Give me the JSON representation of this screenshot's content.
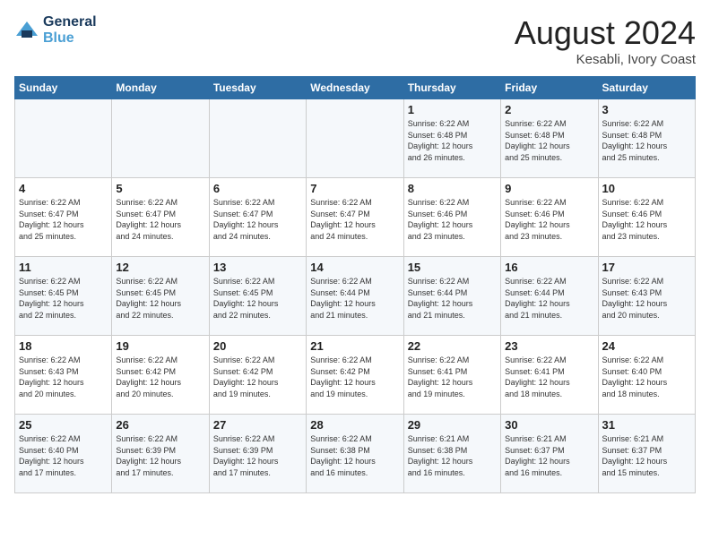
{
  "header": {
    "logo_line1": "General",
    "logo_line2": "Blue",
    "month_year": "August 2024",
    "location": "Kesabli, Ivory Coast"
  },
  "weekdays": [
    "Sunday",
    "Monday",
    "Tuesday",
    "Wednesday",
    "Thursday",
    "Friday",
    "Saturday"
  ],
  "weeks": [
    [
      {
        "day": "",
        "info": ""
      },
      {
        "day": "",
        "info": ""
      },
      {
        "day": "",
        "info": ""
      },
      {
        "day": "",
        "info": ""
      },
      {
        "day": "1",
        "info": "Sunrise: 6:22 AM\nSunset: 6:48 PM\nDaylight: 12 hours\nand 26 minutes."
      },
      {
        "day": "2",
        "info": "Sunrise: 6:22 AM\nSunset: 6:48 PM\nDaylight: 12 hours\nand 25 minutes."
      },
      {
        "day": "3",
        "info": "Sunrise: 6:22 AM\nSunset: 6:48 PM\nDaylight: 12 hours\nand 25 minutes."
      }
    ],
    [
      {
        "day": "4",
        "info": "Sunrise: 6:22 AM\nSunset: 6:47 PM\nDaylight: 12 hours\nand 25 minutes."
      },
      {
        "day": "5",
        "info": "Sunrise: 6:22 AM\nSunset: 6:47 PM\nDaylight: 12 hours\nand 24 minutes."
      },
      {
        "day": "6",
        "info": "Sunrise: 6:22 AM\nSunset: 6:47 PM\nDaylight: 12 hours\nand 24 minutes."
      },
      {
        "day": "7",
        "info": "Sunrise: 6:22 AM\nSunset: 6:47 PM\nDaylight: 12 hours\nand 24 minutes."
      },
      {
        "day": "8",
        "info": "Sunrise: 6:22 AM\nSunset: 6:46 PM\nDaylight: 12 hours\nand 23 minutes."
      },
      {
        "day": "9",
        "info": "Sunrise: 6:22 AM\nSunset: 6:46 PM\nDaylight: 12 hours\nand 23 minutes."
      },
      {
        "day": "10",
        "info": "Sunrise: 6:22 AM\nSunset: 6:46 PM\nDaylight: 12 hours\nand 23 minutes."
      }
    ],
    [
      {
        "day": "11",
        "info": "Sunrise: 6:22 AM\nSunset: 6:45 PM\nDaylight: 12 hours\nand 22 minutes."
      },
      {
        "day": "12",
        "info": "Sunrise: 6:22 AM\nSunset: 6:45 PM\nDaylight: 12 hours\nand 22 minutes."
      },
      {
        "day": "13",
        "info": "Sunrise: 6:22 AM\nSunset: 6:45 PM\nDaylight: 12 hours\nand 22 minutes."
      },
      {
        "day": "14",
        "info": "Sunrise: 6:22 AM\nSunset: 6:44 PM\nDaylight: 12 hours\nand 21 minutes."
      },
      {
        "day": "15",
        "info": "Sunrise: 6:22 AM\nSunset: 6:44 PM\nDaylight: 12 hours\nand 21 minutes."
      },
      {
        "day": "16",
        "info": "Sunrise: 6:22 AM\nSunset: 6:44 PM\nDaylight: 12 hours\nand 21 minutes."
      },
      {
        "day": "17",
        "info": "Sunrise: 6:22 AM\nSunset: 6:43 PM\nDaylight: 12 hours\nand 20 minutes."
      }
    ],
    [
      {
        "day": "18",
        "info": "Sunrise: 6:22 AM\nSunset: 6:43 PM\nDaylight: 12 hours\nand 20 minutes."
      },
      {
        "day": "19",
        "info": "Sunrise: 6:22 AM\nSunset: 6:42 PM\nDaylight: 12 hours\nand 20 minutes."
      },
      {
        "day": "20",
        "info": "Sunrise: 6:22 AM\nSunset: 6:42 PM\nDaylight: 12 hours\nand 19 minutes."
      },
      {
        "day": "21",
        "info": "Sunrise: 6:22 AM\nSunset: 6:42 PM\nDaylight: 12 hours\nand 19 minutes."
      },
      {
        "day": "22",
        "info": "Sunrise: 6:22 AM\nSunset: 6:41 PM\nDaylight: 12 hours\nand 19 minutes."
      },
      {
        "day": "23",
        "info": "Sunrise: 6:22 AM\nSunset: 6:41 PM\nDaylight: 12 hours\nand 18 minutes."
      },
      {
        "day": "24",
        "info": "Sunrise: 6:22 AM\nSunset: 6:40 PM\nDaylight: 12 hours\nand 18 minutes."
      }
    ],
    [
      {
        "day": "25",
        "info": "Sunrise: 6:22 AM\nSunset: 6:40 PM\nDaylight: 12 hours\nand 17 minutes."
      },
      {
        "day": "26",
        "info": "Sunrise: 6:22 AM\nSunset: 6:39 PM\nDaylight: 12 hours\nand 17 minutes."
      },
      {
        "day": "27",
        "info": "Sunrise: 6:22 AM\nSunset: 6:39 PM\nDaylight: 12 hours\nand 17 minutes."
      },
      {
        "day": "28",
        "info": "Sunrise: 6:22 AM\nSunset: 6:38 PM\nDaylight: 12 hours\nand 16 minutes."
      },
      {
        "day": "29",
        "info": "Sunrise: 6:21 AM\nSunset: 6:38 PM\nDaylight: 12 hours\nand 16 minutes."
      },
      {
        "day": "30",
        "info": "Sunrise: 6:21 AM\nSunset: 6:37 PM\nDaylight: 12 hours\nand 16 minutes."
      },
      {
        "day": "31",
        "info": "Sunrise: 6:21 AM\nSunset: 6:37 PM\nDaylight: 12 hours\nand 15 minutes."
      }
    ]
  ]
}
